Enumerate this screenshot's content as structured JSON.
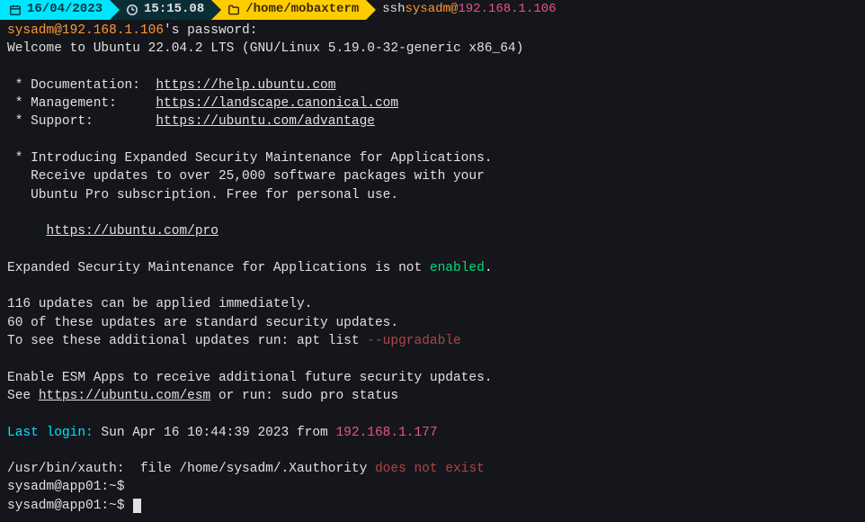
{
  "statusbar": {
    "date": "16/04/2023",
    "time": "15:15.08",
    "path": "/home/mobaxterm",
    "command_prefix": "ssh",
    "command_user": " sysadm",
    "command_at": "@",
    "command_ip": "192.168.1.106"
  },
  "pwline": {
    "user_host": "sysadm@192.168.1.106",
    "suffix": "'s password:"
  },
  "welcome": "Welcome to Ubuntu 22.04.2 LTS (GNU/Linux 5.19.0-32-generic x86_64)",
  "bullets": {
    "doc_label": " * Documentation:  ",
    "doc_link": "https://help.ubuntu.com",
    "mgmt_label": " * Management:     ",
    "mgmt_link": "https://landscape.canonical.com",
    "sup_label": " * Support:        ",
    "sup_link": "https://ubuntu.com/advantage"
  },
  "esm_intro": {
    "l1": " * Introducing Expanded Security Maintenance for Applications.",
    "l2": "   Receive updates to over 25,000 software packages with your",
    "l3": "   Ubuntu Pro subscription. Free for personal use."
  },
  "pro_link_prefix": "     ",
  "pro_link": "https://ubuntu.com/pro",
  "esm_status": {
    "pre": "Expanded Security Maintenance for Applications is not ",
    "word": "enabled",
    "post": "."
  },
  "updates": {
    "l1": "116 updates can be applied immediately.",
    "l2": "60 of these updates are standard security updates.",
    "l3_pre": "To see these additional updates run: apt list ",
    "l3_flag": "--upgradable"
  },
  "enable_esm": {
    "l1": "Enable ESM Apps to receive additional future security updates.",
    "l2_pre": "See ",
    "l2_link": "https://ubuntu.com/esm",
    "l2_post": " or run: sudo pro status"
  },
  "lastlogin": {
    "label": "Last login:",
    "mid": " Sun Apr 16 10:44:39 2023 from ",
    "ip": "192.168.1.177"
  },
  "xauth": {
    "pre": "/usr/bin/xauth:  file /home/sysadm/.Xauthority ",
    "err": "does not exist"
  },
  "prompt1": "sysadm@app01:~$",
  "prompt2": "sysadm@app01:~$"
}
